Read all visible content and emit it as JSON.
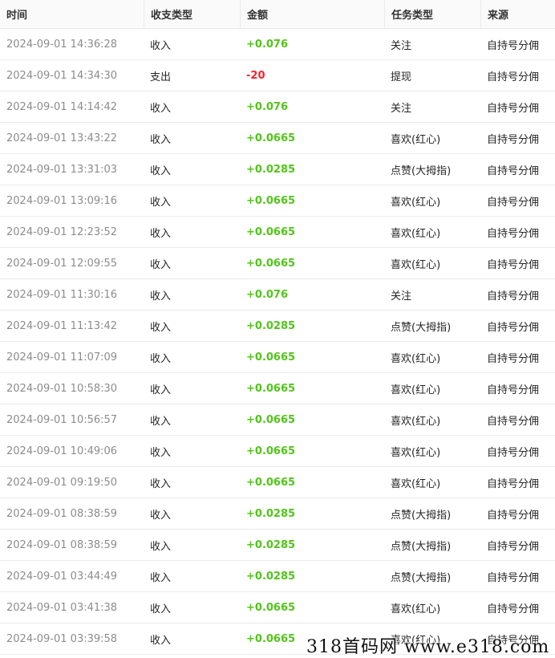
{
  "table": {
    "headers": {
      "time": "时间",
      "kind": "收支类型",
      "amount": "金额",
      "task": "任务类型",
      "source": "来源"
    },
    "rows": [
      {
        "time": "2024-09-01 14:36:28",
        "kind": "收入",
        "amount": "+0.076",
        "task": "关注",
        "source": "自持号分佣"
      },
      {
        "time": "2024-09-01 14:34:30",
        "kind": "支出",
        "amount": "-20",
        "task": "提现",
        "source": "自持号分佣"
      },
      {
        "time": "2024-09-01 14:14:42",
        "kind": "收入",
        "amount": "+0.076",
        "task": "关注",
        "source": "自持号分佣"
      },
      {
        "time": "2024-09-01 13:43:22",
        "kind": "收入",
        "amount": "+0.0665",
        "task": "喜欢(红心)",
        "source": "自持号分佣"
      },
      {
        "time": "2024-09-01 13:31:03",
        "kind": "收入",
        "amount": "+0.0285",
        "task": "点赞(大拇指)",
        "source": "自持号分佣"
      },
      {
        "time": "2024-09-01 13:09:16",
        "kind": "收入",
        "amount": "+0.0665",
        "task": "喜欢(红心)",
        "source": "自持号分佣"
      },
      {
        "time": "2024-09-01 12:23:52",
        "kind": "收入",
        "amount": "+0.0665",
        "task": "喜欢(红心)",
        "source": "自持号分佣"
      },
      {
        "time": "2024-09-01 12:09:55",
        "kind": "收入",
        "amount": "+0.0665",
        "task": "喜欢(红心)",
        "source": "自持号分佣"
      },
      {
        "time": "2024-09-01 11:30:16",
        "kind": "收入",
        "amount": "+0.076",
        "task": "关注",
        "source": "自持号分佣"
      },
      {
        "time": "2024-09-01 11:13:42",
        "kind": "收入",
        "amount": "+0.0285",
        "task": "点赞(大拇指)",
        "source": "自持号分佣"
      },
      {
        "time": "2024-09-01 11:07:09",
        "kind": "收入",
        "amount": "+0.0665",
        "task": "喜欢(红心)",
        "source": "自持号分佣"
      },
      {
        "time": "2024-09-01 10:58:30",
        "kind": "收入",
        "amount": "+0.0665",
        "task": "喜欢(红心)",
        "source": "自持号分佣"
      },
      {
        "time": "2024-09-01 10:56:57",
        "kind": "收入",
        "amount": "+0.0665",
        "task": "喜欢(红心)",
        "source": "自持号分佣"
      },
      {
        "time": "2024-09-01 10:49:06",
        "kind": "收入",
        "amount": "+0.0665",
        "task": "喜欢(红心)",
        "source": "自持号分佣"
      },
      {
        "time": "2024-09-01 09:19:50",
        "kind": "收入",
        "amount": "+0.0665",
        "task": "喜欢(红心)",
        "source": "自持号分佣"
      },
      {
        "time": "2024-09-01 08:38:59",
        "kind": "收入",
        "amount": "+0.0285",
        "task": "点赞(大拇指)",
        "source": "自持号分佣"
      },
      {
        "time": "2024-09-01 08:38:59",
        "kind": "收入",
        "amount": "+0.0285",
        "task": "点赞(大拇指)",
        "source": "自持号分佣"
      },
      {
        "time": "2024-09-01 03:44:49",
        "kind": "收入",
        "amount": "+0.0285",
        "task": "点赞(大拇指)",
        "source": "自持号分佣"
      },
      {
        "time": "2024-09-01 03:41:38",
        "kind": "收入",
        "amount": "+0.0665",
        "task": "喜欢(红心)",
        "source": "自持号分佣"
      },
      {
        "time": "2024-09-01 03:39:58",
        "kind": "收入",
        "amount": "+0.0665",
        "task": "喜欢(红心)",
        "source": "自持号分佣"
      }
    ]
  },
  "colors": {
    "positive": "#52c41a",
    "negative": "#f5222d"
  },
  "watermark": "318首码网 www.e318.com"
}
